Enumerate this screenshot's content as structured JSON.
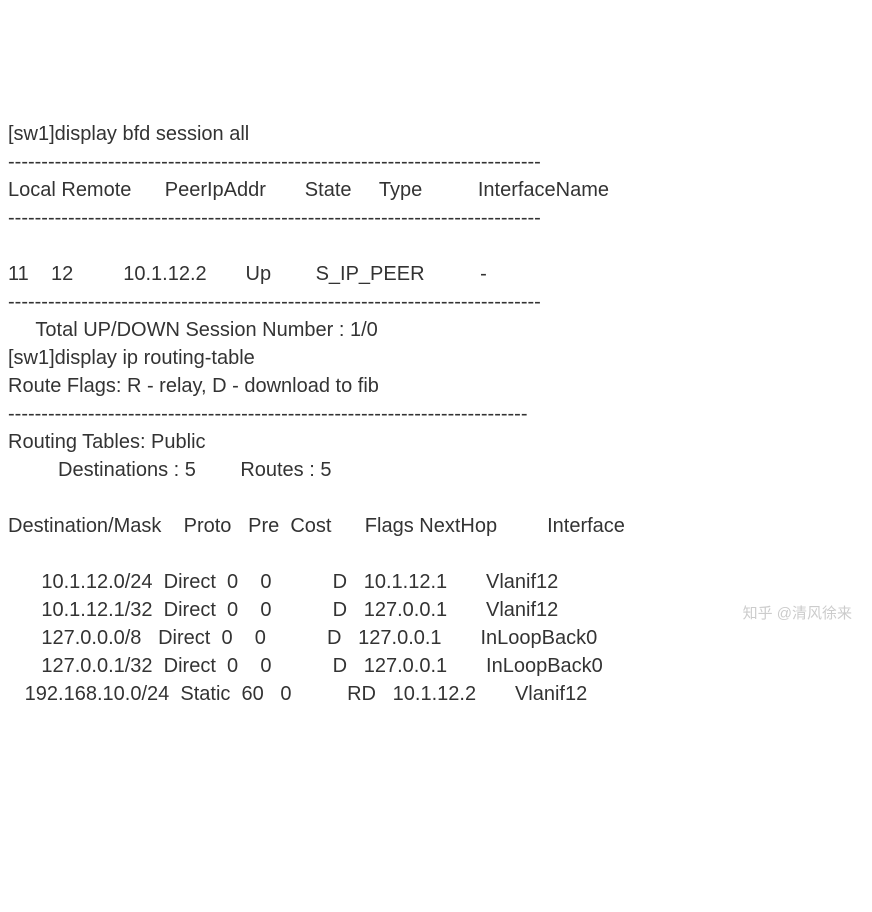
{
  "prompt1": "[sw1]display bfd session all",
  "dash1": "--------------------------------------------------------------------------------",
  "bfdHeader": "Local Remote      PeerIpAddr       State     Type          InterfaceName",
  "dash2": "--------------------------------------------------------------------------------",
  "bfdRow": "11    12         10.1.12.2       Up        S_IP_PEER          -",
  "dash3": "--------------------------------------------------------------------------------",
  "bfdTotal": "     Total UP/DOWN Session Number : 1/0",
  "prompt2": "[sw1]display ip routing-table",
  "routeFlags": "Route Flags: R - relay, D - download to fib",
  "dash4": "------------------------------------------------------------------------------",
  "tablesHeader": "Routing Tables: Public",
  "destCount": "         Destinations : 5        Routes : 5",
  "routeHeader": "Destination/Mask    Proto   Pre  Cost      Flags NextHop         Interface",
  "route1": "      10.1.12.0/24  Direct  0    0           D   10.1.12.1       Vlanif12",
  "route2": "      10.1.12.1/32  Direct  0    0           D   127.0.0.1       Vlanif12",
  "route3": "      127.0.0.0/8   Direct  0    0           D   127.0.0.1       InLoopBack0",
  "route4": "      127.0.0.1/32  Direct  0    0           D   127.0.0.1       InLoopBack0",
  "route5": "   192.168.10.0/24  Static  60   0          RD   10.1.12.2       Vlanif12",
  "watermark": "知乎 @清风徐来",
  "chart_data": {
    "type": "table",
    "bfd_sessions": [
      {
        "Local": 11,
        "Remote": 12,
        "PeerIpAddr": "10.1.12.2",
        "State": "Up",
        "Type": "S_IP_PEER",
        "InterfaceName": "-"
      }
    ],
    "bfd_total_up": 1,
    "bfd_total_down": 0,
    "routing_table": {
      "name": "Public",
      "destinations": 5,
      "routes": 5,
      "entries": [
        {
          "DestinationMask": "10.1.12.0/24",
          "Proto": "Direct",
          "Pre": 0,
          "Cost": 0,
          "Flags": "D",
          "NextHop": "10.1.12.1",
          "Interface": "Vlanif12"
        },
        {
          "DestinationMask": "10.1.12.1/32",
          "Proto": "Direct",
          "Pre": 0,
          "Cost": 0,
          "Flags": "D",
          "NextHop": "127.0.0.1",
          "Interface": "Vlanif12"
        },
        {
          "DestinationMask": "127.0.0.0/8",
          "Proto": "Direct",
          "Pre": 0,
          "Cost": 0,
          "Flags": "D",
          "NextHop": "127.0.0.1",
          "Interface": "InLoopBack0"
        },
        {
          "DestinationMask": "127.0.0.1/32",
          "Proto": "Direct",
          "Pre": 0,
          "Cost": 0,
          "Flags": "D",
          "NextHop": "127.0.0.1",
          "Interface": "InLoopBack0"
        },
        {
          "DestinationMask": "192.168.10.0/24",
          "Proto": "Static",
          "Pre": 60,
          "Cost": 0,
          "Flags": "RD",
          "NextHop": "10.1.12.2",
          "Interface": "Vlanif12"
        }
      ]
    }
  }
}
